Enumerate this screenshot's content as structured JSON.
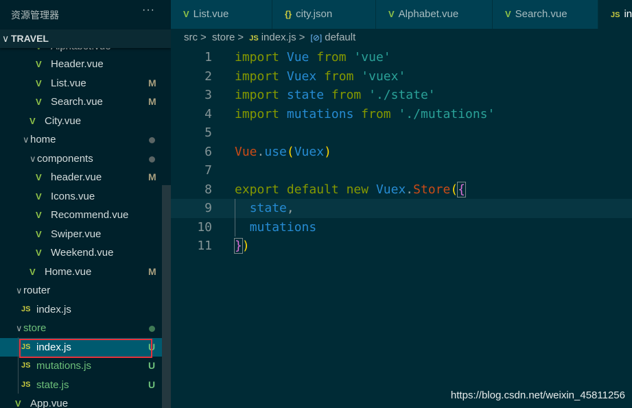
{
  "sidebar": {
    "title": "资源管理器",
    "more": "···",
    "root": "TRAVEL",
    "partial": "Alphabet.vue",
    "items": [
      {
        "label": "Header.vue",
        "icon": "vue-icon",
        "badge": ""
      },
      {
        "label": "List.vue",
        "icon": "vue-icon",
        "badge": "M"
      },
      {
        "label": "Search.vue",
        "icon": "vue-icon",
        "badge": "M"
      },
      {
        "label": "City.vue",
        "icon": "vue-icon",
        "badge": ""
      },
      {
        "label": "home",
        "icon": "folder-open",
        "badge": "dot"
      },
      {
        "label": "components",
        "icon": "folder-open",
        "badge": "dot"
      },
      {
        "label": "header.vue",
        "icon": "vue-icon",
        "badge": "M"
      },
      {
        "label": "Icons.vue",
        "icon": "vue-icon",
        "badge": ""
      },
      {
        "label": "Recommend.vue",
        "icon": "vue-icon",
        "badge": ""
      },
      {
        "label": "Swiper.vue",
        "icon": "vue-icon",
        "badge": ""
      },
      {
        "label": "Weekend.vue",
        "icon": "vue-icon",
        "badge": ""
      },
      {
        "label": "Home.vue",
        "icon": "vue-icon",
        "badge": "M"
      },
      {
        "label": "router",
        "icon": "folder-open",
        "badge": ""
      },
      {
        "label": "index.js",
        "icon": "js-icon",
        "badge": ""
      },
      {
        "label": "store",
        "icon": "folder-open",
        "badge": "dot"
      },
      {
        "label": "index.js",
        "icon": "js-icon",
        "badge": "U",
        "selected": true
      },
      {
        "label": "mutations.js",
        "icon": "js-icon",
        "badge": "U"
      },
      {
        "label": "state.js",
        "icon": "js-icon",
        "badge": "U"
      },
      {
        "label": "App.vue",
        "icon": "vue-icon",
        "badge": ""
      }
    ]
  },
  "tabs": [
    {
      "label": "List.vue",
      "icon": "vue-icon"
    },
    {
      "label": "city.json",
      "icon": "json-icon"
    },
    {
      "label": "Alphabet.vue",
      "icon": "vue-icon"
    },
    {
      "label": "Search.vue",
      "icon": "vue-icon"
    },
    {
      "label": "index.js",
      "icon": "js-icon",
      "active": true
    }
  ],
  "breadcrumb": [
    "src",
    "store",
    "index.js",
    "default"
  ],
  "code": {
    "lines": [
      "1",
      "2",
      "3",
      "4",
      "5",
      "6",
      "7",
      "8",
      "9",
      "10",
      "11"
    ],
    "t": {
      "import": "import",
      "from": "from",
      "Vue": "Vue",
      "Vuex": "Vuex",
      "state": "state",
      "mutations": "mutations",
      "s_vue": "'vue'",
      "s_vuex": "'vuex'",
      "s_state": "'./state'",
      "s_mut": "'./mutations'",
      "use": "use",
      "export": "export",
      "default": "default",
      "new": "new",
      "Store": "Store"
    }
  },
  "icons": {
    "vue": "V",
    "js": "JS",
    "json": "{}",
    "chevron": "∨",
    "chevron_sep": ">"
  },
  "colors": {
    "keyword": "#859900",
    "string": "#2aa198",
    "identifier": "#268bd2",
    "class": "#cb4b16",
    "vue_icon": "#8dc149",
    "js_icon": "#cbcb41",
    "selection_outline": "#e8323c"
  },
  "watermark": "https://blog.csdn.net/weixin_45811256"
}
